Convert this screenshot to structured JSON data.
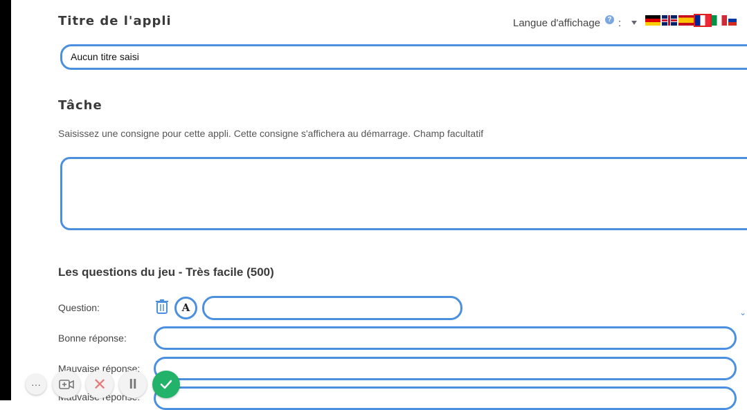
{
  "app_title_section": {
    "heading": "Titre de l'appli",
    "input_value": "Aucun titre saisi"
  },
  "language": {
    "label": "Langue d'affichage",
    "help_glyph": "?",
    "colon": ":",
    "flags": [
      "de",
      "gb",
      "es",
      "fr",
      "it",
      "ru"
    ],
    "selected": "fr"
  },
  "task_section": {
    "heading": "Tâche",
    "description": "Saisissez une consigne pour cette appli. Cette consigne s'affichera au démarrage. Champ facultatif",
    "value": ""
  },
  "questions_section": {
    "title": "Les questions du jeu - Très facile (500)",
    "question_label": "Question:",
    "good_answer_label": "Bonne réponse:",
    "bad_answer_label": "Mauvaise réponse:",
    "bad_answer_label_2": "Mauvaise réponse:",
    "format_glyph": "A"
  },
  "recording_toolbar": {
    "more_glyph": "···",
    "cancel_glyph": "✕",
    "pause_glyph": "II"
  },
  "colors": {
    "field_border": "#4a8fe0",
    "confirm": "#22b26a",
    "cancel": "#e87a7a"
  }
}
